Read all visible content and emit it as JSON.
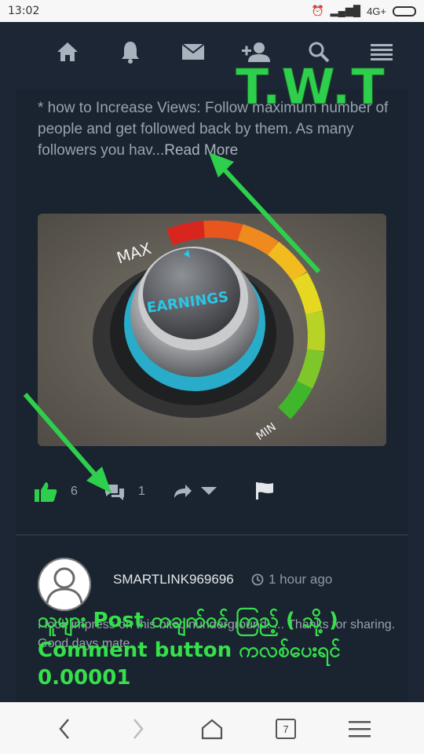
{
  "status": {
    "time": "13:02",
    "network": "4G+"
  },
  "nav": {
    "items": [
      {
        "name": "home",
        "icon": "home-icon"
      },
      {
        "name": "notifications",
        "icon": "bell-icon"
      },
      {
        "name": "messages",
        "icon": "envelope-icon"
      },
      {
        "name": "add-friend",
        "icon": "user-plus-icon"
      },
      {
        "name": "search",
        "icon": "search-icon"
      },
      {
        "name": "menu",
        "icon": "hamburger-icon"
      }
    ]
  },
  "post": {
    "excerpt": "* how to Increase Views: Follow maximum number of people and get followed back by them. As many followers you hav...",
    "read_more": "Read More",
    "image": {
      "text_max": "MAX",
      "text_min": "MIN",
      "knob_label": "EARNINGS"
    },
    "likes": "6",
    "comments": "1"
  },
  "comment": {
    "username": "SMARTLINK969696",
    "time": "1 hour ago",
    "text": "I look impress on this bitcoinunderground. ... Thanks for sharing. Good days mate."
  },
  "overlay": {
    "watermark": "T.W.T",
    "caption_line1": "သူများ Post တချက်ဝင် ကြည့် ( သို့ )",
    "caption_line2": "Comment button ကလစ်ပေးရင်",
    "caption_line3": "0.00001"
  },
  "browser": {
    "tab_count": "7"
  },
  "colors": {
    "accent_green": "#35e04b",
    "bg": "#1c2634"
  }
}
